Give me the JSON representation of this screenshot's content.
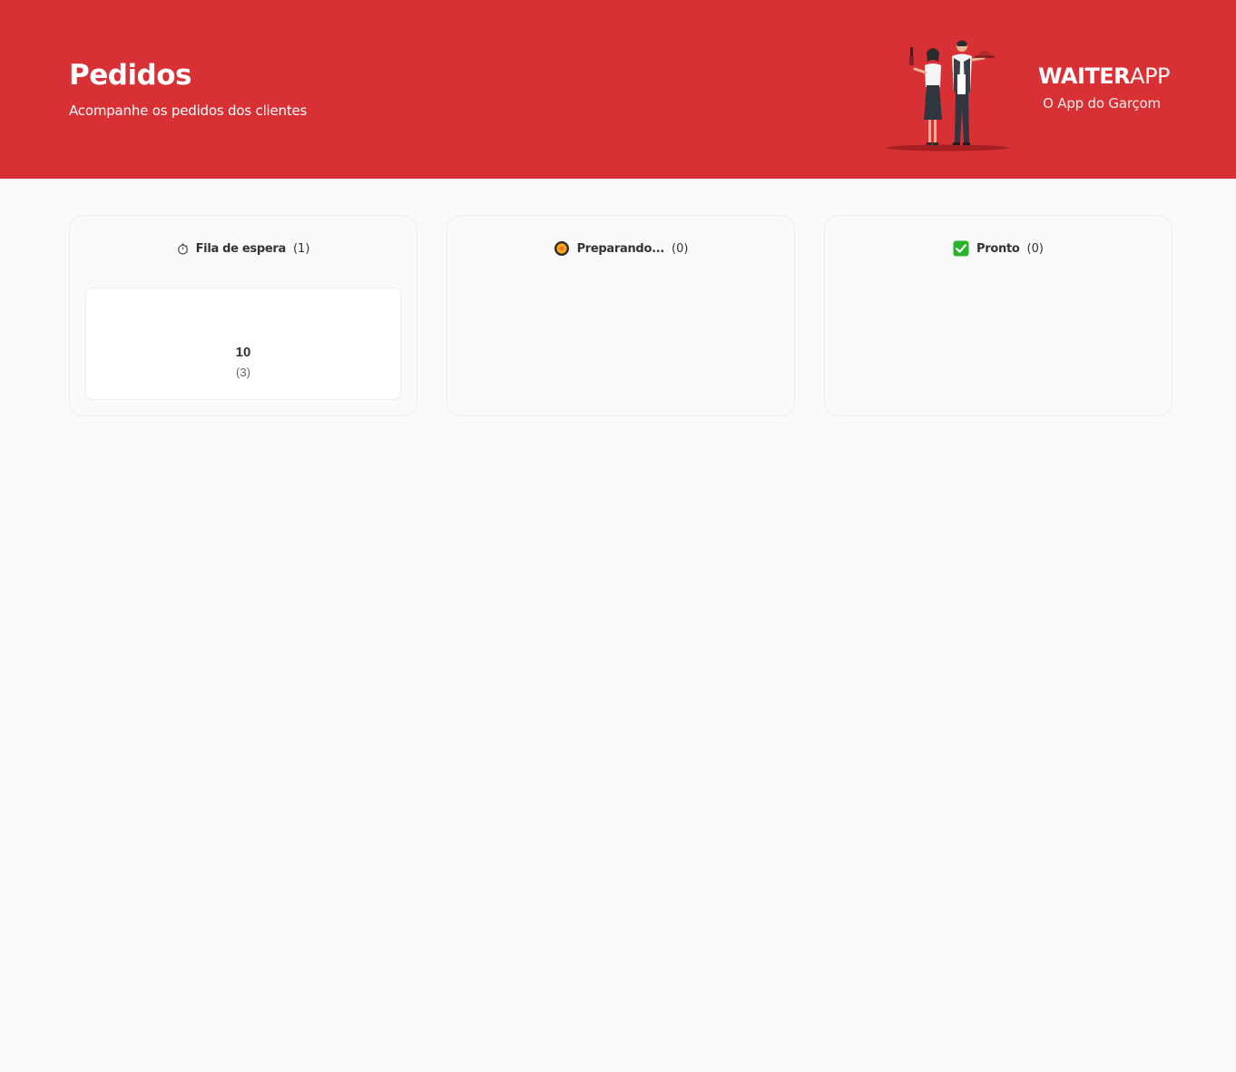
{
  "header": {
    "title": "Pedidos",
    "subtitle": "Acompanhe os pedidos dos clientes",
    "illustration_icon": "waiters-illustration-icon",
    "background_color": "#d73035"
  },
  "brand": {
    "logo_strong": "WAITER",
    "logo_light": "APP",
    "tagline": "O App do Garçom"
  },
  "board": {
    "columns": [
      {
        "icon": "stopwatch-icon",
        "title": "Fila de espera",
        "count": "(1)",
        "orders": [
          {
            "table": "10",
            "items": "(3)"
          }
        ]
      },
      {
        "icon": "cooking-icon",
        "title": "Preparando...",
        "count": "(0)",
        "orders": []
      },
      {
        "icon": "check-icon",
        "title": "Pronto",
        "count": "(0)",
        "orders": []
      }
    ]
  }
}
